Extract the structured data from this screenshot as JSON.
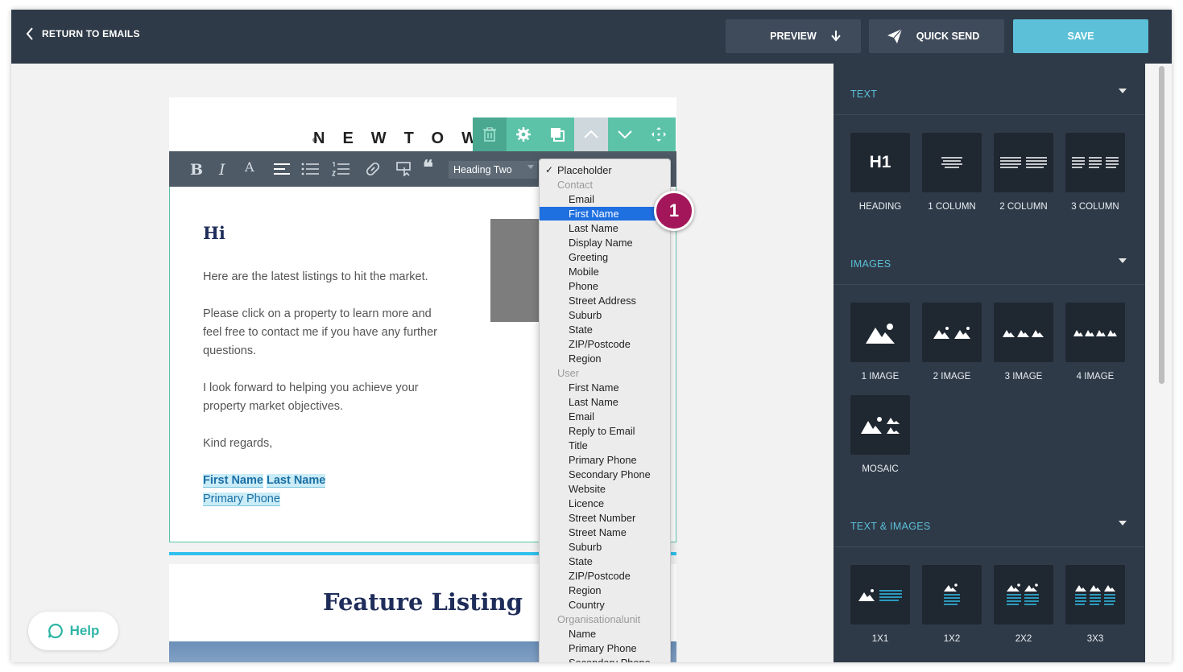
{
  "topbar": {
    "back_label": "RETURN TO EMAILS",
    "preview_label": "PREVIEW",
    "quick_send_label": "QUICK SEND",
    "save_label": "SAVE",
    "save_color": "#5bc0d8"
  },
  "email": {
    "logo_text": "NEWTOW",
    "greeting": "Hi",
    "paragraphs": [
      "Here are the latest listings to hit the market.",
      "Please click on a property to learn more and feel free to contact me if you have any further questions.",
      "I look forward to helping you achieve your property market objectives.",
      "Kind regards,"
    ],
    "signature": {
      "first_name": "First Name",
      "last_name": "Last Name",
      "phone": "Primary Phone"
    },
    "feature_title": "Feature Listing"
  },
  "editor_toolbar": {
    "heading_select": "Heading Two"
  },
  "placeholder_dropdown": {
    "header": "Placeholder",
    "groups": [
      {
        "label": "Contact",
        "items": [
          "Email",
          "First Name",
          "Last Name",
          "Display Name",
          "Greeting",
          "Mobile",
          "Phone",
          "Street Address",
          "Suburb",
          "State",
          "ZIP/Postcode",
          "Region"
        ]
      },
      {
        "label": "User",
        "items": [
          "First Name",
          "Last Name",
          "Email",
          "Reply to Email",
          "Title",
          "Primary Phone",
          "Secondary Phone",
          "Website",
          "Licence",
          "Street Number",
          "Street Name",
          "Suburb",
          "State",
          "ZIP/Postcode",
          "Region",
          "Country"
        ]
      },
      {
        "label": "Organisationalunit",
        "items": [
          "Name",
          "Primary Phone",
          "Secondary Phone"
        ]
      }
    ],
    "selected": "First Name"
  },
  "step_badge": "1",
  "help_label": "Help",
  "panel": {
    "text_section": "TEXT",
    "text_tiles": [
      "HEADING",
      "1 COLUMN",
      "2 COLUMN",
      "3 COLUMN"
    ],
    "heading_tile_glyph": "H1",
    "images_section": "IMAGES",
    "image_tiles": [
      "1 IMAGE",
      "2 IMAGE",
      "3 IMAGE",
      "4 IMAGE",
      "MOSAIC"
    ],
    "text_images_section": "TEXT & IMAGES",
    "text_image_tiles": [
      "1X1",
      "1X2",
      "2X2",
      "3X3"
    ]
  }
}
